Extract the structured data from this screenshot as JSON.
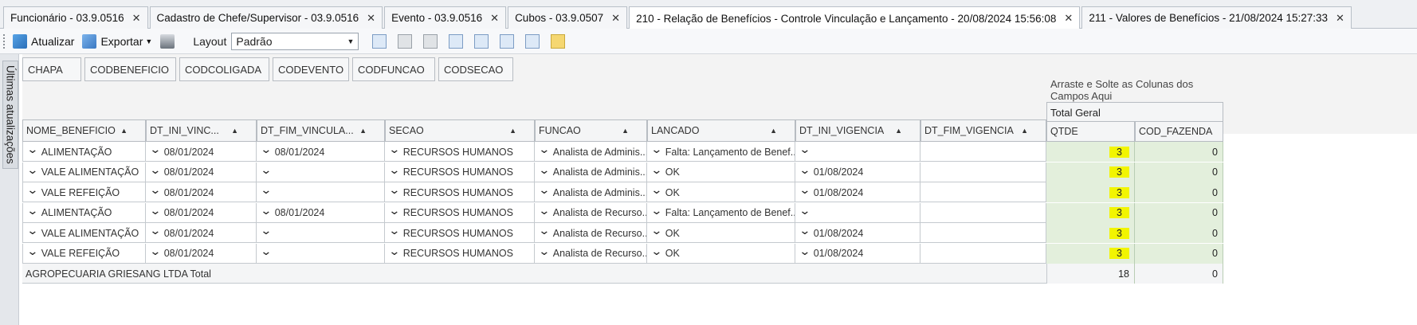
{
  "tabs": [
    {
      "label": "Funcionário - 03.9.0516",
      "active": false
    },
    {
      "label": "Cadastro de Chefe/Supervisor - 03.9.0516",
      "active": false
    },
    {
      "label": "Evento - 03.9.0516",
      "active": false
    },
    {
      "label": "Cubos - 03.9.0507",
      "active": false
    },
    {
      "label": "210 - Relação de Benefícios - Controle Vinculação e Lançamento - 20/08/2024 15:56:08",
      "active": true
    },
    {
      "label": "211 - Valores de Benefícios - 21/08/2024 15:27:33",
      "active": false
    }
  ],
  "toolbar": {
    "refresh_label": "Atualizar",
    "export_label": "Exportar",
    "layout_label": "Layout",
    "layout_value": "Padrão"
  },
  "side_panel": {
    "label": "Últimas atualizações"
  },
  "filter_fields": [
    "CHAPA",
    "CODBENEFICIO",
    "CODCOLIGADA",
    "CODEVENTO",
    "CODFUNCAO",
    "CODSECAO"
  ],
  "drop_hint": "Arraste e Solte as Colunas dos Campos Aqui",
  "total_geral": "Total Geral",
  "row_headers": [
    "NOME_BENEFICIO",
    "DT_INI_VINC...",
    "DT_FIM_VINCULA...",
    "SECAO",
    "FUNCAO",
    "LANCADO",
    "DT_INI_VIGENCIA",
    "DT_FIM_VIGENCIA"
  ],
  "value_headers": [
    "QTDE",
    "COD_FAZENDA"
  ],
  "rows": [
    {
      "cells": [
        "ALIMENTAÇÃO",
        "08/01/2024",
        "08/01/2024",
        "RECURSOS HUMANOS",
        "Analista de Adminis...",
        "Falta: Lançamento de Benef...",
        "",
        ""
      ],
      "qtde": "3",
      "cod_fazenda": "0"
    },
    {
      "cells": [
        "VALE ALIMENTAÇÃO",
        "08/01/2024",
        "",
        "RECURSOS HUMANOS",
        "Analista de Adminis...",
        "OK",
        "01/08/2024",
        ""
      ],
      "qtde": "3",
      "cod_fazenda": "0"
    },
    {
      "cells": [
        "VALE REFEIÇÃO",
        "08/01/2024",
        "",
        "RECURSOS HUMANOS",
        "Analista de Adminis...",
        "OK",
        "01/08/2024",
        ""
      ],
      "qtde": "3",
      "cod_fazenda": "0"
    },
    {
      "cells": [
        "ALIMENTAÇÃO",
        "08/01/2024",
        "08/01/2024",
        "RECURSOS HUMANOS",
        "Analista de Recurso...",
        "Falta: Lançamento de Benef...",
        "",
        ""
      ],
      "qtde": "3",
      "cod_fazenda": "0"
    },
    {
      "cells": [
        "VALE ALIMENTAÇÃO",
        "08/01/2024",
        "",
        "RECURSOS HUMANOS",
        "Analista de Recurso...",
        "OK",
        "01/08/2024",
        ""
      ],
      "qtde": "3",
      "cod_fazenda": "0"
    },
    {
      "cells": [
        "VALE REFEIÇÃO",
        "08/01/2024",
        "",
        "RECURSOS HUMANOS",
        "Analista de Recurso...",
        "OK",
        "01/08/2024",
        ""
      ],
      "qtde": "3",
      "cod_fazenda": "0"
    }
  ],
  "total_row": {
    "label": "AGROPECUARIA GRIESANG LTDA Total",
    "qtde": "18",
    "cod_fazenda": "0"
  },
  "colors": {
    "value_bg": "#e3efdc",
    "highlight": "#f2f500"
  }
}
